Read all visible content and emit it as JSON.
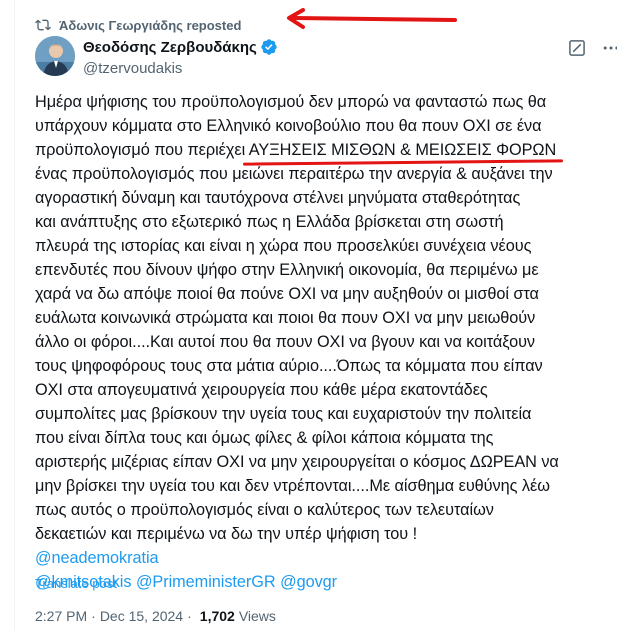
{
  "repost": {
    "label": "Άδωνις Γεωργιάδης reposted",
    "icon": "repost-icon"
  },
  "author": {
    "display_name": "Θεοδόσης Ζερβουδάκης",
    "handle": "@tzervoudakis",
    "verified": true,
    "avatar": "avatar"
  },
  "actions": {
    "grok_icon": "grok-icon",
    "more_icon": "more-icon"
  },
  "tweet": {
    "lines": [
      "Ημέρα ψήφισης του προϋπολογισμού δεν μπορώ να φανταστώ πως θα",
      "υπάρχουν κόμματα στο Ελληνικό κοινοβούλιο που θα πουν ΟΧΙ σε ένα",
      "προϋπολογισμό που περιέχει ",
      "ΑΥΞΗΣΕΙΣ ΜΙΣΘΩΝ & ΜΕΙΩΣΕΙΣ ΦΟΡΩΝ",
      "ένας προϋπολογισμός που μειώνει περαιτέρω την ανεργία & αυξάνει την",
      "αγοραστική δύναμη και ταυτόχρονα στέλνει μηνύματα σταθερότητας",
      "και ανάπτυξης στο εξωτερικό πως η Ελλάδα βρίσκεται στη σωστή",
      "πλευρά της ιστορίας και είναι η χώρα που προσελκύει συνέχεια νέους",
      "επενδυτές που δίνουν ψήφο στην Ελληνική οικονομία, θα περιμένω με",
      "χαρά να δω απόψε ποιοί θα πούνε ΟΧΙ να μην αυξηθούν οι μισθοί στα",
      "ευάλωτα κοινωνικά στρώματα και ποιοι θα πουν ΟΧΙ να μην μειωθούν",
      "άλλο οι φόροι....Και αυτοί που θα πουν ΟΧΙ να βγουν και να κοιτάξουν",
      "τους ψηφοφόρους τους στα μάτια αύριο....Όπως τα κόμματα που είπαν",
      "ΟΧΙ στα απογευματινά χειρουργεία που κάθε μέρα εκατοντάδες",
      "συμπολίτες μας βρίσκουν την υγεία τους και ευχαριστούν την πολιτεία",
      "που είναι δίπλα τους και όμως φίλες & φίλοι κάποια κόμματα της",
      "αριστερής μιζέριας είπαν ΟΧΙ να μην χειρουργείται ο κόσμος ΔΩΡΕΑΝ να",
      "μην βρίσκει την υγεία του και δεν ντρέπονται....Με αίσθημα ευθύνης λέω",
      "πως αυτός ο προϋπολογισμός είναι ο καλύτερος των τελευταίων",
      "δεκαετιών και περιμένω να δω την υπέρ ψήφιση του ! "
    ],
    "mentions": [
      "@neademokratia",
      "@kmitsotakis",
      "@PrimeministerGR",
      "@govgr"
    ]
  },
  "translate_label": "Translate post",
  "meta": {
    "time": "2:27 PM",
    "separator": "·",
    "date": "Dec 15, 2024",
    "views_count": "1,702",
    "views_label": "Views"
  },
  "colors": {
    "link": "#1d9bf0",
    "annotation": "#e21414",
    "verified": "#1d9bf0"
  }
}
